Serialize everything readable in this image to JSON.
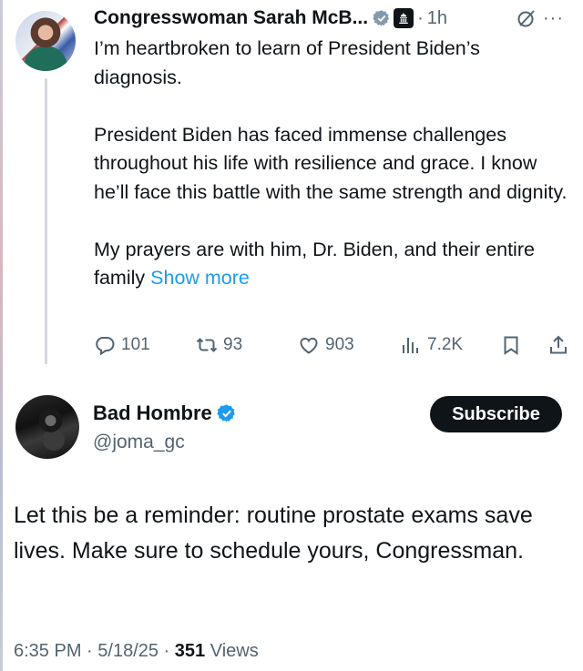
{
  "parent_tweet": {
    "author_name": "Congresswoman Sarah McB...",
    "time": "1h",
    "separator": "·",
    "text_paragraphs": [
      "I’m heartbroken to learn of President Biden’s diagnosis.",
      "President Biden has faced immense challenges throughout his life with resilience and grace. I know he’ll face this battle with the same strength and dignity.",
      "My prayers are with him, Dr. Biden, and their entire family"
    ],
    "show_more_label": "Show more",
    "more_label": "···",
    "actions": {
      "replies": "101",
      "reposts": "93",
      "likes": "903",
      "views": "7.2K"
    }
  },
  "reply_tweet": {
    "author_name": "Bad Hombre",
    "handle": "@joma_gc",
    "subscribe_label": "Subscribe",
    "text": "Let this be a reminder: routine prostate exams save lives. Make sure to schedule yours, Congressman.",
    "meta": {
      "time": "6:35 PM",
      "sep1": " · ",
      "date": "5/18/25",
      "sep2": " · ",
      "views_count": "351",
      "views_label": " Views"
    }
  },
  "colors": {
    "text_primary": "#0f1419",
    "text_secondary": "#536471",
    "link_blue": "#1d9bf0",
    "verified_blue": "#1d9bf0",
    "gov_gray": "#829aab",
    "subscribe_bg": "#0f1419"
  },
  "icons": {
    "parent_avatar": "avatar-photo",
    "gray_badge": "gray-verified-badge-icon",
    "government_icon": "capitol-icon",
    "grok_icon": "grok-icon",
    "reply_icon": "speech-bubble-icon",
    "repost_icon": "repost-icon",
    "like_icon": "heart-icon",
    "views_icon": "bar-chart-icon",
    "bookmark_icon": "bookmark-icon",
    "share_icon": "share-icon",
    "verified_icon": "blue-verified-badge-icon"
  }
}
